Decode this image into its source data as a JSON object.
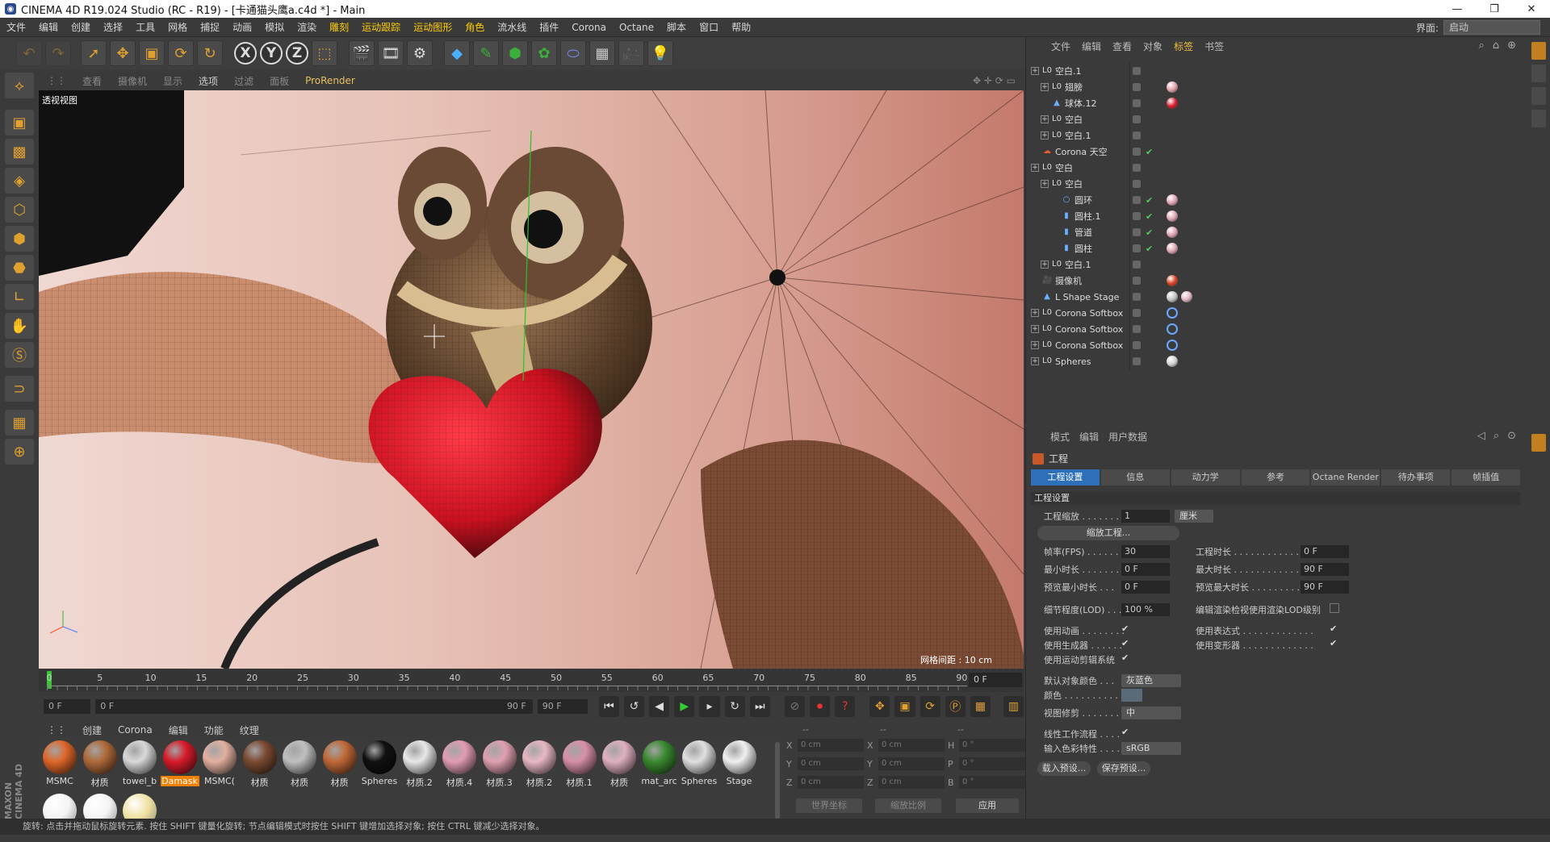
{
  "titlebar": {
    "title": "CINEMA 4D R19.024 Studio (RC - R19) - [卡通猫头鹰a.c4d *] - Main",
    "app_icon": "cinema4d-icon"
  },
  "menubar": {
    "items": [
      "文件",
      "编辑",
      "创建",
      "选择",
      "工具",
      "网格",
      "捕捉",
      "动画",
      "模拟",
      "渲染",
      "雕刻",
      "运动跟踪",
      "运动图形",
      "角色",
      "流水线",
      "插件",
      "Corona",
      "Octane",
      "脚本",
      "窗口",
      "帮助"
    ],
    "interface_label": "界面:",
    "interface_value": "启动"
  },
  "viewport": {
    "menu": [
      "查看",
      "摄像机",
      "显示",
      "选项",
      "过滤",
      "面板"
    ],
    "active_menu": "选项",
    "renderer": "ProRender",
    "label": "透视视图",
    "grid_label": "网格间距 : 10 cm"
  },
  "timeline": {
    "ticks": [
      "0",
      "5",
      "10",
      "15",
      "20",
      "25",
      "30",
      "35",
      "40",
      "45",
      "50",
      "55",
      "60",
      "65",
      "70",
      "75",
      "80",
      "85",
      "90"
    ],
    "current_frame": "0 F"
  },
  "transport": {
    "start": "0 F",
    "range_start": "0 F",
    "range_end": "90 F",
    "end": "90 F"
  },
  "materials": {
    "menu": [
      "创建",
      "Corona",
      "编辑",
      "功能",
      "纹理"
    ],
    "items": [
      {
        "name": "MSMC",
        "color": "#e0672a"
      },
      {
        "name": "材质",
        "color": "#b06a3a"
      },
      {
        "name": "towel_b",
        "color": "#d9d9d9"
      },
      {
        "name": "Damask",
        "color": "#d81b2c",
        "selected": true
      },
      {
        "name": "MSMC(",
        "color": "#e3b0a0"
      },
      {
        "name": "材质",
        "color": "#7b4a32"
      },
      {
        "name": "材质",
        "color": "#c0c0c0"
      },
      {
        "name": "材质",
        "color": "#c06838"
      },
      {
        "name": "Spheres",
        "color": "#111111"
      },
      {
        "name": "材质.2",
        "color": "#e8e8e8"
      },
      {
        "name": "材质.4",
        "color": "#e29cb4"
      },
      {
        "name": "材质.3",
        "color": "#e0a0b0"
      },
      {
        "name": "材质.2",
        "color": "#e8b8c4"
      },
      {
        "name": "材质.1",
        "color": "#d890a8"
      },
      {
        "name": "材质",
        "color": "#e0b0c0"
      },
      {
        "name": "mat_arc",
        "color": "#3a8a30"
      },
      {
        "name": "Spheres",
        "color": "#e0e0e0"
      },
      {
        "name": "Stage",
        "color": "#f0f0f0"
      }
    ],
    "row2": [
      {
        "name": "",
        "color": "#f4f4f4"
      },
      {
        "name": "",
        "color": "#f4f4f4"
      },
      {
        "name": "",
        "color": "#f0e0a0"
      }
    ]
  },
  "coords": {
    "headers": [
      "--",
      "--",
      "--"
    ],
    "rows": [
      {
        "a": "X",
        "v1": "0 cm",
        "b": "X",
        "v2": "0 cm",
        "c": "H",
        "v3": "0 °"
      },
      {
        "a": "Y",
        "v1": "0 cm",
        "b": "Y",
        "v2": "0 cm",
        "c": "P",
        "v3": "0 °"
      },
      {
        "a": "Z",
        "v1": "0 cm",
        "b": "Z",
        "v2": "0 cm",
        "c": "B",
        "v3": "0 °"
      }
    ],
    "world": "世界坐标",
    "scale": "缩放比例",
    "apply": "应用"
  },
  "objects": {
    "menu": [
      "文件",
      "编辑",
      "查看",
      "对象",
      "标签",
      "书签"
    ],
    "active_menu": "标签",
    "rows": [
      {
        "name": "空白.1",
        "level": 0,
        "expand": true,
        "icon": "L0"
      },
      {
        "name": "翅膀",
        "level": 1,
        "expand": true,
        "icon": "L0"
      },
      {
        "name": "球体.12",
        "level": 1,
        "expand": false,
        "icon": "sphere"
      },
      {
        "name": "空白",
        "level": 1,
        "expand": true,
        "icon": "L0"
      },
      {
        "name": "空白.1",
        "level": 1,
        "expand": true,
        "icon": "L0"
      },
      {
        "name": "Corona 天空",
        "level": 0,
        "expand": false,
        "icon": "sky"
      },
      {
        "name": "空白",
        "level": 0,
        "expand": true,
        "icon": "L0"
      },
      {
        "name": "空白",
        "level": 1,
        "expand": true,
        "icon": "L0"
      },
      {
        "name": "圆环",
        "level": 2,
        "expand": false,
        "icon": "torus"
      },
      {
        "name": "圆柱.1",
        "level": 2,
        "expand": false,
        "icon": "cyl"
      },
      {
        "name": "管道",
        "level": 2,
        "expand": false,
        "icon": "cyl"
      },
      {
        "name": "圆柱",
        "level": 2,
        "expand": false,
        "icon": "cyl"
      },
      {
        "name": "空白.1",
        "level": 1,
        "expand": true,
        "icon": "L0"
      },
      {
        "name": "摄像机",
        "level": 0,
        "expand": false,
        "icon": "cam"
      },
      {
        "name": "L Shape Stage",
        "level": 0,
        "expand": false,
        "icon": "stage"
      },
      {
        "name": "Corona Softbox",
        "level": 0,
        "expand": true,
        "icon": "L0"
      },
      {
        "name": "Corona Softbox",
        "level": 0,
        "expand": true,
        "icon": "L0"
      },
      {
        "name": "Corona Softbox",
        "level": 0,
        "expand": true,
        "icon": "L0"
      },
      {
        "name": "Spheres",
        "level": 0,
        "expand": true,
        "icon": "L0"
      }
    ]
  },
  "attributes": {
    "menu": [
      "模式",
      "编辑",
      "用户数据"
    ],
    "title": "工程",
    "tabs": [
      "工程设置",
      "信息",
      "动力学",
      "参考",
      "Octane Render",
      "待办事项",
      "帧插值"
    ],
    "section": "工程设置",
    "scale_label": "工程缩放 . . . . . . . .",
    "scale_value": "1",
    "scale_unit": "厘米",
    "scale_button": "缩放工程...",
    "fps_label": "帧率(FPS) . . . . . . .",
    "fps_value": "30",
    "proj_len_label": "工程时长 . . . . . . . . . . . . . . .",
    "proj_len_value": "0 F",
    "min_len_label": "最小时长 . . . . . . .",
    "min_len_value": "0 F",
    "max_len_label": "最大时长 . . . . . . . . . . . . . . .",
    "max_len_value": "90 F",
    "prev_min_label": "预览最小时长 . . .",
    "prev_min_value": "0 F",
    "prev_max_label": "预览最大时长 . . . . . . . . . . . .",
    "prev_max_value": "90 F",
    "lod_label": "细节程度(LOD) . . .",
    "lod_value": "100 %",
    "lod_render_label": "编辑渲染检视使用渲染LOD级别",
    "use_anim": "使用动画 . . . . . . . .",
    "use_expr": "使用表达式 . . . . . . . . . . . . .",
    "use_gen": "使用生成器 . . . . . .",
    "use_deform": "使用变形器 . . . . . . . . . . . . .",
    "use_motion": "使用运动剪辑系统",
    "default_color_label": "默认对象颜色 . . .",
    "default_color_value": "灰蓝色",
    "color_label": "颜色 . . . . . . . . . . .",
    "clip_label": "视图修剪 . . . . . . . .",
    "clip_value": "中",
    "linear_label": "线性工作流程 . . . .",
    "input_profile_label": "输入色彩特性 . . . .",
    "input_profile_value": "sRGB",
    "load_preset": "载入预设...",
    "save_preset": "保存预设..."
  },
  "statusbar": {
    "text": "旋转: 点击并拖动鼠标旋转元素. 按住 SHIFT 键量化旋转; 节点编辑模式时按住 SHIFT 键增加选择对象; 按住 CTRL 键减少选择对象。"
  },
  "brand": {
    "maxon": "MAXON",
    "c4d": "CINEMA 4D"
  }
}
